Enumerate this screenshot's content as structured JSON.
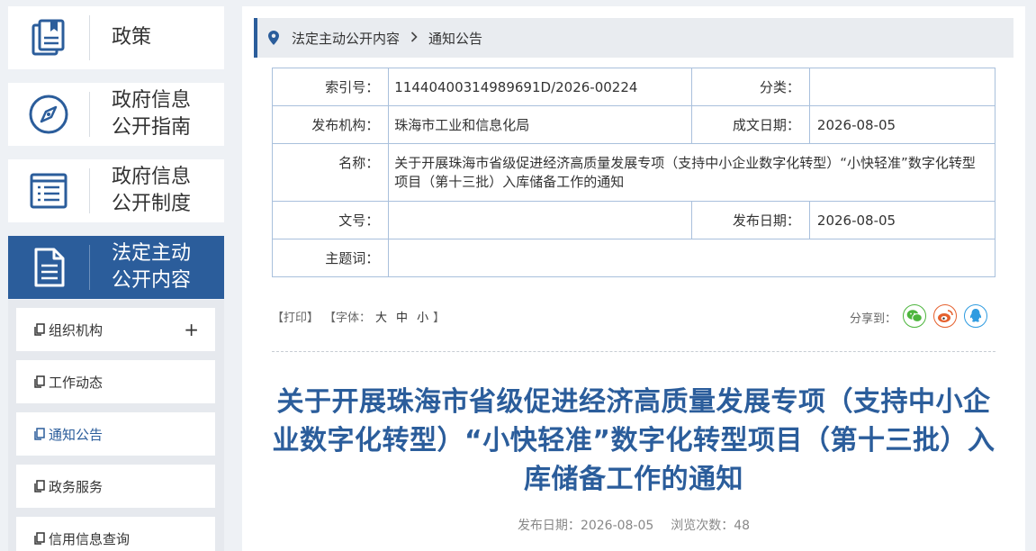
{
  "sidebar": {
    "cards": [
      {
        "label": "政策",
        "icon": "document-book-icon"
      },
      {
        "label": "政府信息公开指南",
        "icon": "compass-icon"
      },
      {
        "label": "政府信息公开制度",
        "icon": "list-doc-icon"
      },
      {
        "label": "法定主动公开内容",
        "icon": "file-icon",
        "active": true
      }
    ],
    "sub_items": [
      {
        "label": "组织机构",
        "expand": "+"
      },
      {
        "label": "工作动态"
      },
      {
        "label": "通知公告",
        "active": true
      },
      {
        "label": "政务服务"
      },
      {
        "label": "信用信息查询"
      }
    ]
  },
  "breadcrumb": {
    "items": [
      "法定主动公开内容",
      "通知公告"
    ]
  },
  "meta": {
    "index_label": "索引号：",
    "index_value": "11440400314989691D/2026-00224",
    "category_label": "分类：",
    "category_value": "",
    "publisher_label": "发布机构：",
    "publisher_value": "珠海市工业和信息化局",
    "written_date_label": "成文日期：",
    "written_date_value": "2026-08-05",
    "name_label": "名称：",
    "name_value": "关于开展珠海市省级促进经济高质量发展专项（支持中小企业数字化转型）“小快轻准”数字化转型项目（第十三批）入库储备工作的通知",
    "docno_label": "文号：",
    "docno_value": "",
    "publish_date_label": "发布日期：",
    "publish_date_value": "2026-08-05",
    "subject_label": "主题词：",
    "subject_value": ""
  },
  "toolbar": {
    "print": "【打印】",
    "font_prefix": "【字体：",
    "font_large": "大",
    "font_medium": "中",
    "font_small": "小",
    "font_suffix": "】",
    "share_label": "分享到：",
    "share_icons": [
      "wechat-icon",
      "weibo-icon",
      "qq-icon"
    ]
  },
  "article": {
    "title": "关于开展珠海市省级促进经济高质量发展专项（支持中小企业数字化转型）“小快轻准”数字化转型项目（第十三批）入库储备工作的通知",
    "pub_date_label": "发布日期：",
    "pub_date": "2026-08-05",
    "views_label": "浏览次数：",
    "views": "48"
  },
  "colors": {
    "accent": "#2b5d9b",
    "wechat": "#4cb53c",
    "weibo": "#e5602d",
    "qq": "#2e9be0"
  }
}
